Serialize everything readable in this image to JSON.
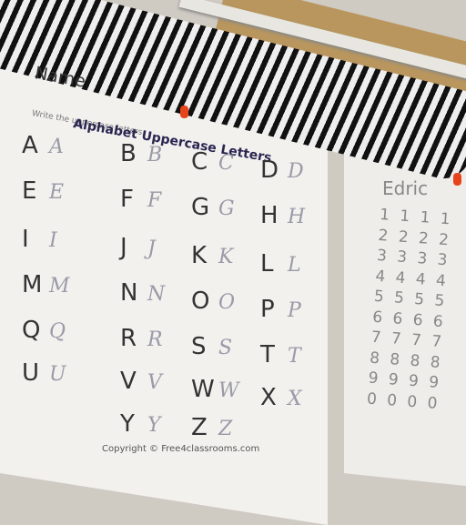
{
  "worksheet": {
    "name_label": "Name",
    "title": "Alphabet Uppercase Letters",
    "instruction": "Write the uppercase letters",
    "letters": [
      "A",
      "B",
      "C",
      "D",
      "E",
      "F",
      "G",
      "H",
      "I",
      "J",
      "K",
      "L",
      "M",
      "N",
      "O",
      "P",
      "Q",
      "R",
      "S",
      "T",
      "U",
      "V",
      "W",
      "X",
      "Y",
      "Z"
    ],
    "copyright": "Copyright © Free4classrooms.com"
  },
  "number_sheet": {
    "name": "Edric",
    "rows": [
      "1 1 1 1",
      "2 2 2 2",
      "3 3 3 3",
      "4 4 4 4",
      "5 5 5 5",
      "6 6 6 6",
      "7 7 7 7",
      "8 8 8 8",
      "9 9 9 9",
      "0 0 0 0"
    ]
  },
  "colors": {
    "pin": "#e8441c",
    "title": "#2a2550",
    "cork": "#b8965e"
  }
}
